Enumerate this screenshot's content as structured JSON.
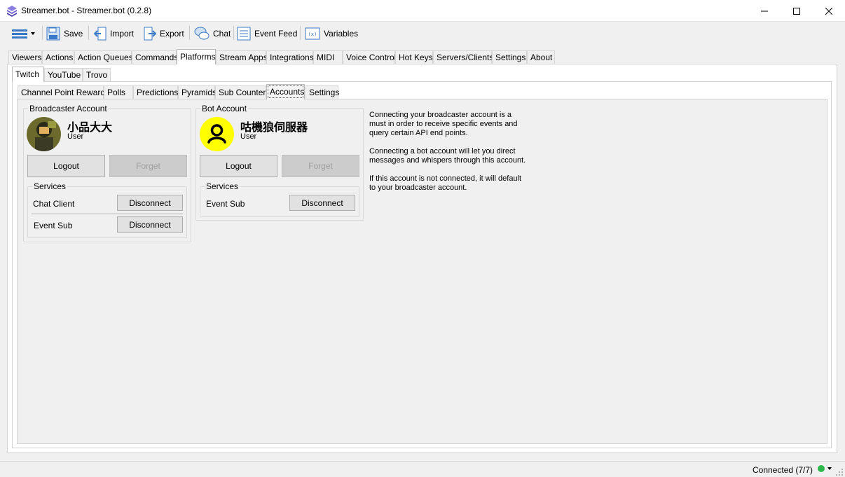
{
  "window": {
    "title": "Streamer.bot - Streamer.bot (0.2.8)",
    "icon": "streamerbot-logo-icon",
    "accent_color": "#6a5acd"
  },
  "toolbar": {
    "menu_icon": "menu-lines-icon",
    "save": "Save",
    "import": "Import",
    "export": "Export",
    "chat": "Chat",
    "event_feed": "Event Feed",
    "variables": "Variables"
  },
  "main_tabs": [
    "Viewers",
    "Actions",
    "Action Queues",
    "Commands",
    "Platforms",
    "Stream Apps",
    "Integrations",
    "MIDI",
    "Voice Control",
    "Hot Keys",
    "Servers/Clients",
    "Settings",
    "About"
  ],
  "platform_tabs": [
    "Twitch",
    "YouTube",
    "Trovo"
  ],
  "twitch_tabs": [
    "Channel Point Rewards",
    "Polls",
    "Predictions",
    "Pyramids",
    "Sub Counter",
    "Accounts",
    "Settings"
  ],
  "broadcaster": {
    "group_title": "Broadcaster Account",
    "name": "小品大大",
    "role": "User",
    "logout": "Logout",
    "forget": "Forget",
    "services_title": "Services",
    "services": [
      {
        "name": "Chat Client",
        "button": "Disconnect"
      },
      {
        "name": "Event Sub",
        "button": "Disconnect"
      }
    ]
  },
  "bot": {
    "group_title": "Bot Account",
    "name": "咕機狼伺服器",
    "role": "User",
    "avatar_color": "#ffff00",
    "logout": "Logout",
    "forget": "Forget",
    "services_title": "Services",
    "services": [
      {
        "name": "Event Sub",
        "button": "Disconnect"
      }
    ]
  },
  "info": {
    "line1": "Connecting your broadcaster account is a",
    "line2": "must in order to receive specific events and",
    "line3": "query certain API end points.",
    "line4": "Connecting a bot account will let you direct",
    "line5": "messages and whispers through this account.",
    "line6": "If this account is not connected, it will default",
    "line7": "to your broadcaster account."
  },
  "status": {
    "text": "Connected (7/7)",
    "dot_color": "#2db84d"
  }
}
